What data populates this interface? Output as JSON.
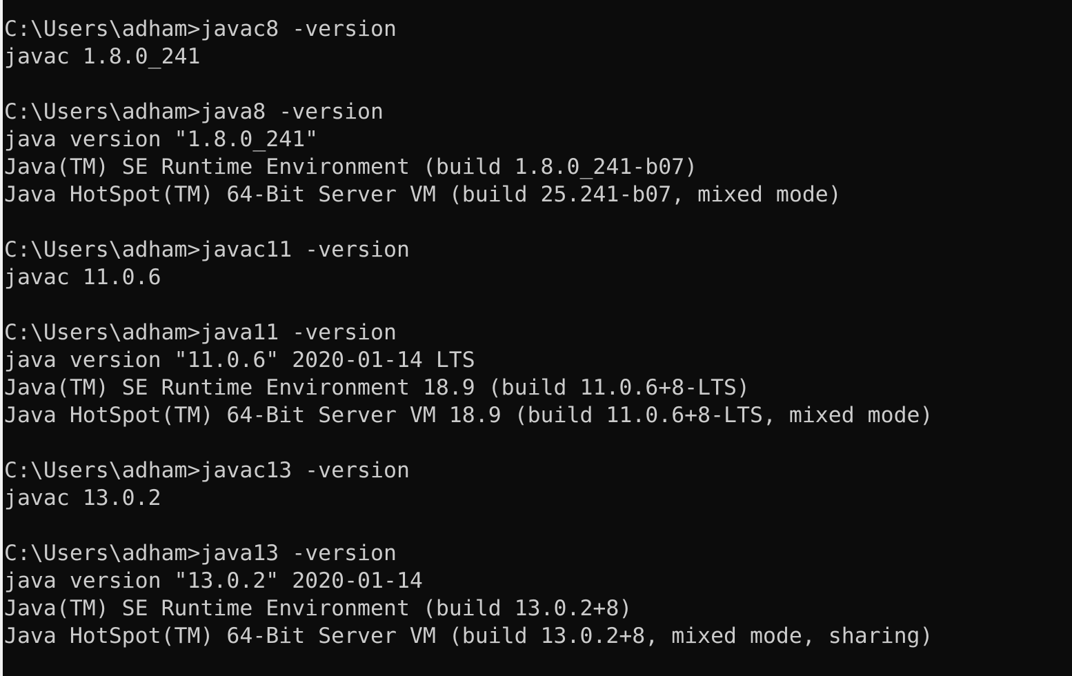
{
  "console": {
    "lines": [
      "C:\\Users\\adham>javac8 -version",
      "javac 1.8.0_241",
      "",
      "C:\\Users\\adham>java8 -version",
      "java version \"1.8.0_241\"",
      "Java(TM) SE Runtime Environment (build 1.8.0_241-b07)",
      "Java HotSpot(TM) 64-Bit Server VM (build 25.241-b07, mixed mode)",
      "",
      "C:\\Users\\adham>javac11 -version",
      "javac 11.0.6",
      "",
      "C:\\Users\\adham>java11 -version",
      "java version \"11.0.6\" 2020-01-14 LTS",
      "Java(TM) SE Runtime Environment 18.9 (build 11.0.6+8-LTS)",
      "Java HotSpot(TM) 64-Bit Server VM 18.9 (build 11.0.6+8-LTS, mixed mode)",
      "",
      "C:\\Users\\adham>javac13 -version",
      "javac 13.0.2",
      "",
      "C:\\Users\\adham>java13 -version",
      "java version \"13.0.2\" 2020-01-14",
      "Java(TM) SE Runtime Environment (build 13.0.2+8)",
      "Java HotSpot(TM) 64-Bit Server VM (build 13.0.2+8, mixed mode, sharing)"
    ]
  },
  "colors": {
    "background": "#0c0c0c",
    "text": "#cccccc"
  }
}
